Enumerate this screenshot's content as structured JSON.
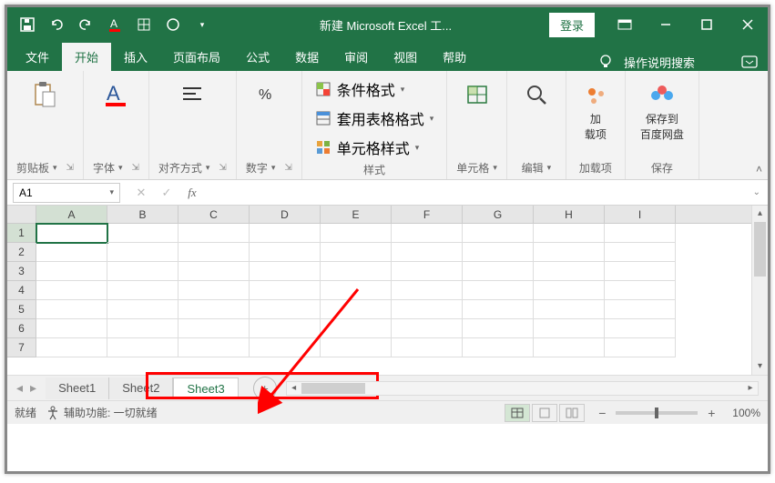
{
  "titlebar": {
    "title": "新建 Microsoft Excel 工...",
    "login": "登录"
  },
  "ribbon_tabs": {
    "file": "文件",
    "home": "开始",
    "insert": "插入",
    "page_layout": "页面布局",
    "formulas": "公式",
    "data": "数据",
    "review": "审阅",
    "view": "视图",
    "help": "帮助",
    "tell_me": "操作说明搜索"
  },
  "groups": {
    "clipboard": "剪贴板",
    "font": "字体",
    "alignment": "对齐方式",
    "number": "数字",
    "styles": "样式",
    "cells": "单元格",
    "editing": "编辑",
    "addins": "加载项",
    "save": "保存",
    "cond_fmt": "条件格式",
    "table_fmt": "套用表格格式",
    "cell_style": "单元格样式",
    "addins_btn": "加\n载项",
    "baidu": "保存到\n百度网盘"
  },
  "namebox": {
    "value": "A1"
  },
  "columns": [
    "A",
    "B",
    "C",
    "D",
    "E",
    "F",
    "G",
    "H",
    "I"
  ],
  "rows": [
    "1",
    "2",
    "3",
    "4",
    "5",
    "6",
    "7"
  ],
  "sheets": {
    "s1": "Sheet1",
    "s2": "Sheet2",
    "s3": "Sheet3"
  },
  "status": {
    "ready": "就绪",
    "accessibility": "辅助功能: 一切就绪",
    "zoom": "100%"
  }
}
